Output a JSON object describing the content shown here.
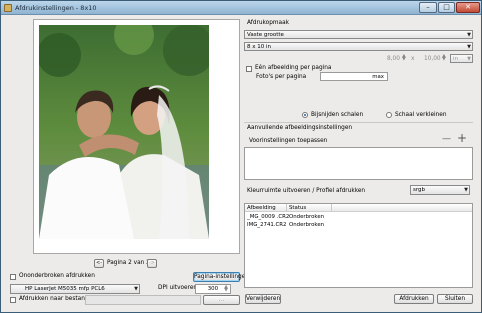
{
  "window": {
    "title": "Afdrukinstellingen - 8x10"
  },
  "preview": {
    "prev_label": "<-",
    "next_label": "->",
    "page_text": "Pagina 2 van 2"
  },
  "left_bottom": {
    "continuous_label": "Ononderbroken afdrukken",
    "page_settings_label": "Pagina-instellingen",
    "printer_value": "HP LaserJet M5035 mfp PCL6",
    "dpi_label": "DPI uitvoeren",
    "dpi_value": "300",
    "to_file_label": "Afdrukken naar bestand",
    "browse_label": "..."
  },
  "layout": {
    "heading": "Afdrukopmaak",
    "mode_value": "Vaste grootte",
    "size_value": "8 x 10 in",
    "width_value": "8,00",
    "times": "x",
    "height_value": "10,00",
    "unit_value": "in",
    "one_per_page_label": "Eén afbeelding per pagina",
    "photos_per_page_label": "Foto's per pagina",
    "photos_max": "max",
    "crop_label": "Bijsnijden schalen",
    "shrink_label": "Schaal verkleinen"
  },
  "extra": {
    "heading": "Aanvullende afbeeldingsinstellingen",
    "presets_label": "Voorinstellingen toepassen",
    "minus_label": "—",
    "plus_label": "+",
    "color_label": "Kleurruimte uitvoeren / Profiel afdrukken",
    "color_value": "srgb"
  },
  "table": {
    "columns": [
      "Afbeelding",
      "Status"
    ],
    "rows": [
      [
        "_MG_0009 .CR2",
        "Onderbroken"
      ],
      [
        "IMG_2741.CR2",
        "Onderbroken"
      ]
    ]
  },
  "actions": {
    "remove_label": "Verwijderen",
    "print_label": "Afdrukken",
    "close_label": "Sluiten"
  },
  "icons": {
    "dropdown": "chevron-down-icon",
    "spinner": "spinner-arrows-icon",
    "close": "close-icon"
  },
  "window_controls": {
    "minimize": "–",
    "maximize": "□",
    "close": "✕"
  }
}
